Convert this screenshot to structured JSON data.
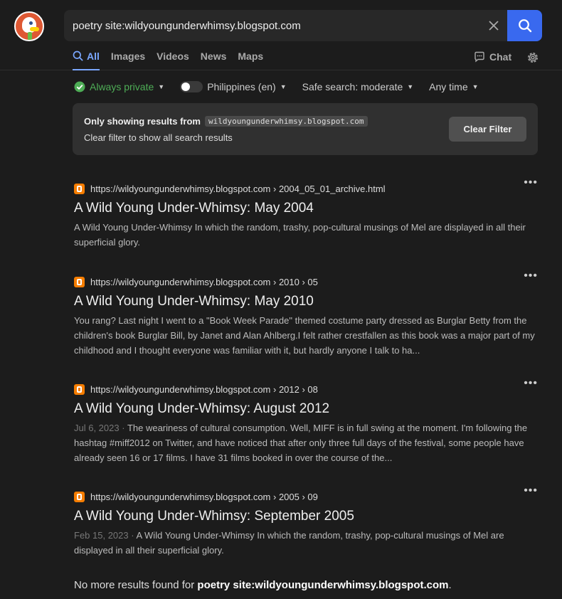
{
  "search": {
    "query": "poetry site:wildyoungunderwhimsy.blogspot.com",
    "clear_icon": "close-icon",
    "search_icon": "magnifier-icon"
  },
  "tabs": [
    {
      "label": "All",
      "active": true
    },
    {
      "label": "Images"
    },
    {
      "label": "Videos"
    },
    {
      "label": "News"
    },
    {
      "label": "Maps"
    }
  ],
  "header": {
    "chat_label": "Chat"
  },
  "filters": {
    "privacy": "Always private",
    "region": "Philippines (en)",
    "safe_search": "Safe search: moderate",
    "time": "Any time"
  },
  "site_filter": {
    "prefix": "Only showing results from",
    "site": "wildyoungunderwhimsy.blogspot.com",
    "hint": "Clear filter to show all search results",
    "button": "Clear Filter"
  },
  "results": [
    {
      "url": "https://wildyoungunderwhimsy.blogspot.com › 2004_05_01_archive.html",
      "title": "A Wild Young Under-Whimsy: May 2004",
      "date": "",
      "snippet": "A Wild Young Under-Whimsy In which the random, trashy, pop-cultural musings of Mel are displayed in all their superficial glory."
    },
    {
      "url": "https://wildyoungunderwhimsy.blogspot.com › 2010 › 05",
      "title": "A Wild Young Under-Whimsy: May 2010",
      "date": "",
      "snippet": "You rang? Last night I went to a \"Book Week Parade\" themed costume party dressed as Burglar Betty from the children's book Burglar Bill, by Janet and Alan Ahlberg.I felt rather crestfallen as this book was a major part of my childhood and I thought everyone was familiar with it, but hardly anyone I talk to ha..."
    },
    {
      "url": "https://wildyoungunderwhimsy.blogspot.com › 2012 › 08",
      "title": "A Wild Young Under-Whimsy: August 2012",
      "date": "Jul 6, 2023",
      "snippet": "The weariness of cultural consumption. Well, MIFF is in full swing at the moment. I'm following the hashtag #miff2012 on Twitter, and have noticed that after only three full days of the festival, some people have already seen 16 or 17 films. I have 31 films booked in over the course of the..."
    },
    {
      "url": "https://wildyoungunderwhimsy.blogspot.com › 2005 › 09",
      "title": "A Wild Young Under-Whimsy: September 2005",
      "date": "Feb 15, 2023",
      "snippet": "A Wild Young Under-Whimsy In which the random, trashy, pop-cultural musings of Mel are displayed in all their superficial glory."
    }
  ],
  "footer": {
    "no_more_prefix": "No more results found for",
    "query": "poetry site:wildyoungunderwhimsy.blogspot.com",
    "suffix": "."
  },
  "colors": {
    "accent": "#3969ef",
    "private": "#4ead56",
    "blogger": "#f57d00"
  }
}
